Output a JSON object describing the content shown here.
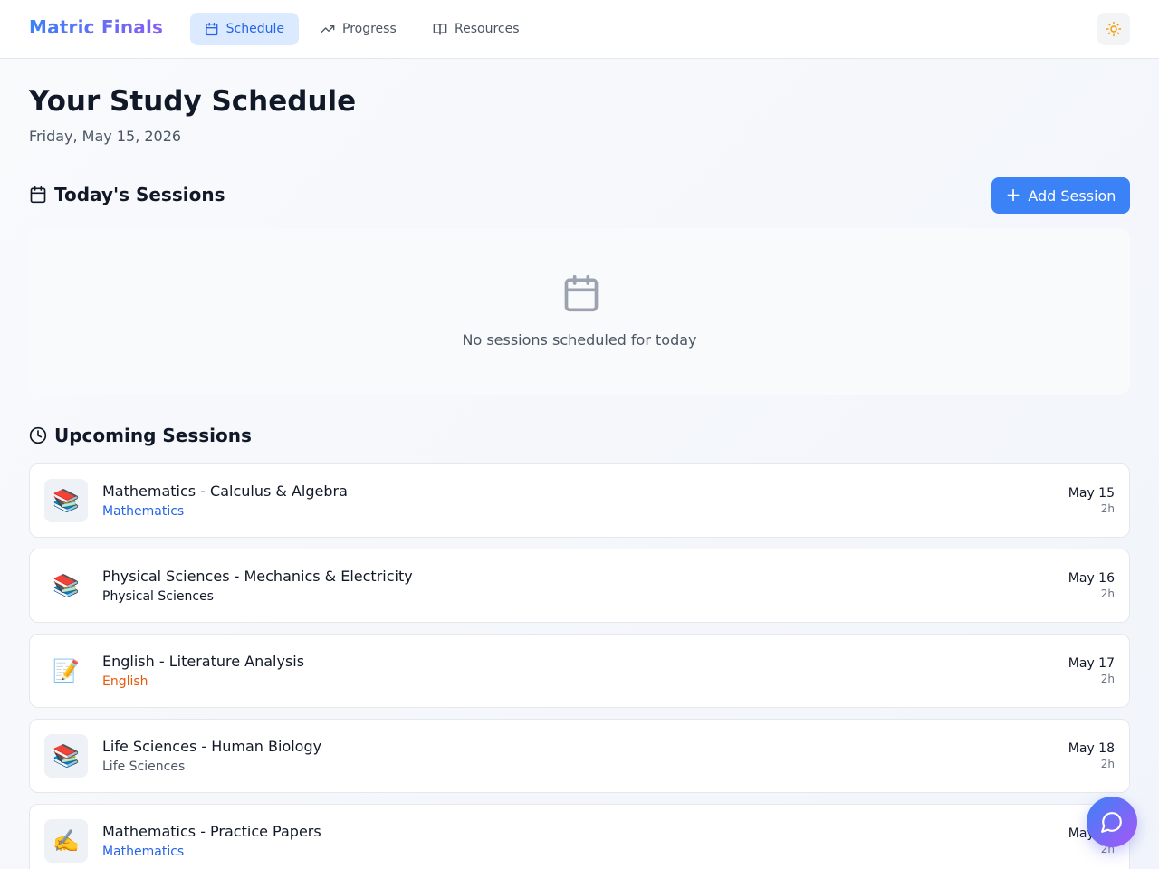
{
  "app": {
    "title": "Matric Finals"
  },
  "nav": {
    "tabs": [
      {
        "label": "Schedule",
        "icon": "calendar-icon",
        "active": true
      },
      {
        "label": "Progress",
        "icon": "trending-up-icon",
        "active": false
      },
      {
        "label": "Resources",
        "icon": "book-open-icon",
        "active": false
      }
    ],
    "theme_toggle_icon": "sun-icon"
  },
  "page": {
    "title": "Your Study Schedule",
    "date": "Friday, May 15, 2026"
  },
  "today": {
    "heading": "Today's Sessions",
    "add_button_label": "Add Session",
    "empty_text": "No sessions scheduled for today"
  },
  "upcoming": {
    "heading": "Upcoming Sessions",
    "sessions": [
      {
        "title": "Mathematics - Calculus & Algebra",
        "subject": "Mathematics",
        "subject_color": "#2563eb",
        "date": "May 15",
        "duration": "2h",
        "emoji": "📚",
        "boxed": true
      },
      {
        "title": "Physical Sciences - Mechanics & Electricity",
        "subject": "Physical Sciences",
        "subject_color": "#111827",
        "date": "May 16",
        "duration": "2h",
        "emoji": "📚",
        "boxed": false
      },
      {
        "title": "English - Literature Analysis",
        "subject": "English",
        "subject_color": "#ea580c",
        "date": "May 17",
        "duration": "2h",
        "emoji": "📝",
        "boxed": false
      },
      {
        "title": "Life Sciences - Human Biology",
        "subject": "Life Sciences",
        "subject_color": "#4b5563",
        "date": "May 18",
        "duration": "2h",
        "emoji": "📚",
        "boxed": true
      },
      {
        "title": "Mathematics - Practice Papers",
        "subject": "Mathematics",
        "subject_color": "#2563eb",
        "date": "May 19",
        "duration": "2h",
        "emoji": "✍️",
        "boxed": true
      }
    ]
  },
  "colors": {
    "accent": "#3b82f6",
    "brand_gradient_start": "#3b82f6",
    "brand_gradient_end": "#8b5cf6"
  }
}
